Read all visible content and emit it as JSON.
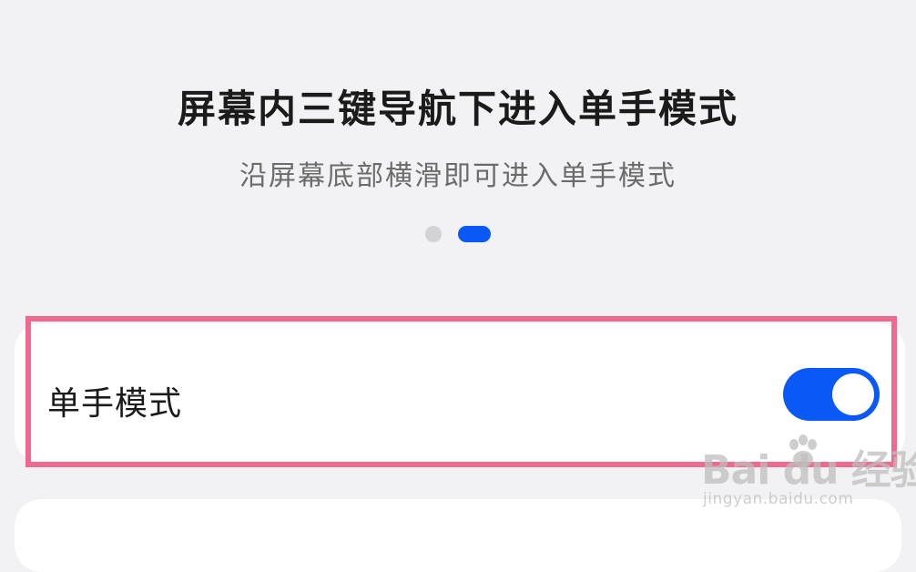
{
  "guide": {
    "title": "屏幕内三键导航下进入单手模式",
    "subtitle": "沿屏幕底部横滑即可进入单手模式",
    "pager": {
      "page_count": 2,
      "active_page": 2
    }
  },
  "setting": {
    "label": "单手模式",
    "toggle_on": true
  },
  "watermark": {
    "main": "Bai du 经验",
    "sub": "jingyan.baidu.com"
  },
  "colors": {
    "background": "#f2f2f5",
    "accent": "#0a59f7",
    "highlight": "#f0698e",
    "card": "#ffffff"
  }
}
